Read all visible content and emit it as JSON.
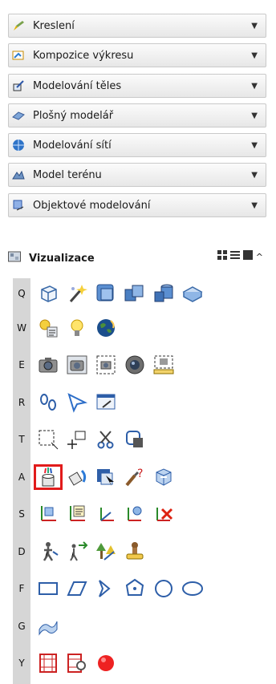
{
  "panels": [
    {
      "title": "Kreslení",
      "icon": "pencil-icon"
    },
    {
      "title": "Kompozice výkresu",
      "icon": "layout-icon"
    },
    {
      "title": "Modelování těles",
      "icon": "solid-pencil-icon"
    },
    {
      "title": "Plošný modelář",
      "icon": "surface-icon"
    },
    {
      "title": "Modelování sítí",
      "icon": "mesh-globe-icon"
    },
    {
      "title": "Model terénu",
      "icon": "terrain-icon"
    },
    {
      "title": "Objektové modelování",
      "icon": "object-model-icon"
    }
  ],
  "active_panel": {
    "title": "Vizualizace",
    "icon": "visualization-icon"
  },
  "rows": [
    {
      "key": "Q",
      "tools": [
        "cube-icon",
        "wand-icon",
        "box-views-icon",
        "boxes-stack-icon",
        "cylinder-view-icon",
        "box-flat-icon"
      ]
    },
    {
      "key": "W",
      "tools": [
        "light-settings-icon",
        "bulb-icon",
        "globe-icon"
      ]
    },
    {
      "key": "E",
      "tools": [
        "camera-icon",
        "camera-frame-icon",
        "camera-region-icon",
        "lens-icon",
        "camera-ruler-icon"
      ]
    },
    {
      "key": "R",
      "tools": [
        "footprints-icon",
        "arrow-pointer-icon",
        "window-arrow-icon"
      ]
    },
    {
      "key": "T",
      "tools": [
        "region-select-icon",
        "cross-arrows-icon",
        "scissors-icon",
        "block-attach-icon"
      ]
    },
    {
      "key": "A",
      "tools": [
        "paint-bucket-icon",
        "paint-pour-icon",
        "material-cursor-icon",
        "brush-question-icon",
        "render-cube-icon"
      ],
      "selected": 0
    },
    {
      "key": "S",
      "tools": [
        "ucs-cube-icon",
        "ucs-list-icon",
        "ucs-arrow-icon",
        "ucs-gear-icon",
        "ucs-delete-icon"
      ]
    },
    {
      "key": "D",
      "tools": [
        "walk-icon",
        "walk-arrows-icon",
        "trees-icon",
        "stamp-icon"
      ]
    },
    {
      "key": "F",
      "tools": [
        "rectangle-icon",
        "parallelogram-icon",
        "chevron-shape-icon",
        "polygon-icon",
        "circle-icon",
        "ellipse-icon"
      ]
    },
    {
      "key": "G",
      "tools": [
        "surface-shape-icon"
      ]
    },
    {
      "key": "Y",
      "tools": [
        "film-icon",
        "film-search-icon",
        "record-icon"
      ]
    }
  ]
}
